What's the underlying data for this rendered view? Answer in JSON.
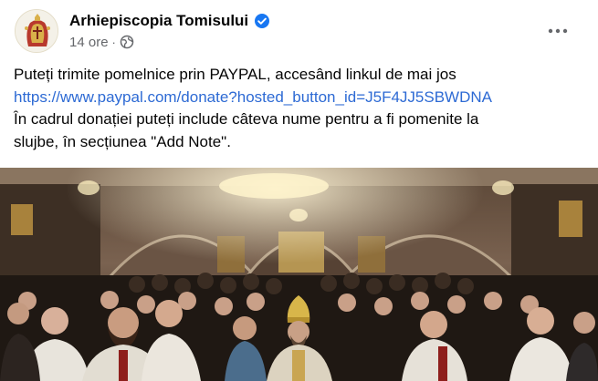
{
  "post": {
    "page_name": "Arhiepiscopia Tomisului",
    "timestamp": "14 ore",
    "separator": "·",
    "icons": {
      "avatar": "church-crest-icon",
      "verified": "verified-badge-icon",
      "audience": "globe-icon",
      "menu": "more-options-icon"
    },
    "colors": {
      "text": "#050505",
      "secondary": "#65676b",
      "link": "#2d6ad4",
      "verified": "#1877f2"
    },
    "text_lines": [
      "Puteți trimite pomelnice prin PAYPAL, accesând linkul de mai jos",
      "https://www.paypal.com/donate?hosted_button_id=J5F4JJ5SBWDNA",
      "În cadrul donației puteți include câteva nume pentru a fi pomenite la",
      "slujbe, în secțiunea \"Add Note\"."
    ]
  }
}
